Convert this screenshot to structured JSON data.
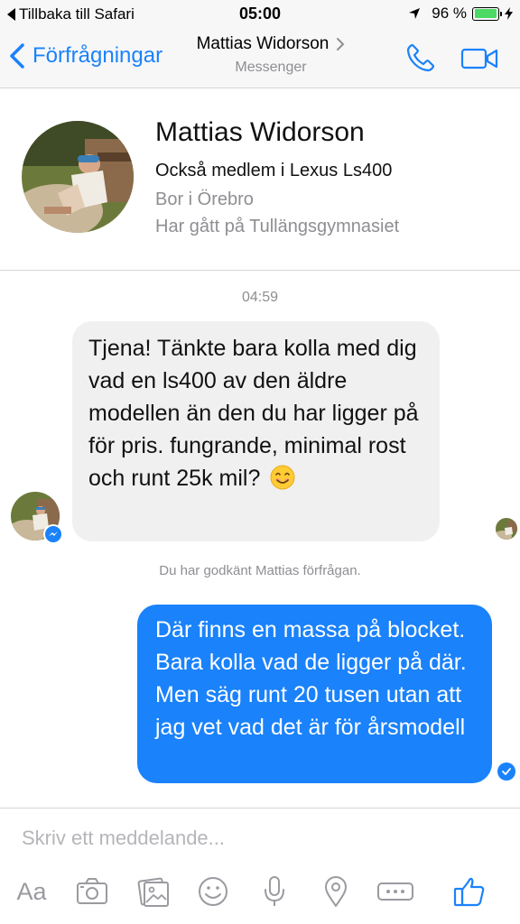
{
  "status_bar": {
    "back_label": "Tillbaka till Safari",
    "time": "05:00",
    "battery_percent": "96 %",
    "battery_level": 0.96,
    "battery_color": "#4cd964"
  },
  "nav": {
    "back_label": "Förfrågningar",
    "title": "Mattias Widorson",
    "subtitle": "Messenger",
    "accent": "#1a82fb",
    "icons": [
      "chevron-left-icon",
      "chevron-right-icon",
      "phone-icon",
      "video-icon"
    ]
  },
  "profile": {
    "name": "Mattias Widorson",
    "member_of": "Också medlem i  Lexus Ls400",
    "city": "Bor i Örebro",
    "school": "Har gått på Tullängsgymnasiet"
  },
  "conversation": {
    "timestamp": "04:59",
    "incoming": {
      "text": "Tjena! Tänkte bara kolla med dig vad en ls400 av den äldre modellen än den du har ligger på för pris. fungrande, minimal rost och runt 25k mil?",
      "emoji": "smiling-face-icon"
    },
    "system_message": "Du har godkänt Mattias förfrågan.",
    "outgoing": {
      "text": "Där finns en massa på blocket. Bara kolla vad de ligger på där. Men säg runt 20 tusen utan att jag vet vad det är för årsmodell"
    }
  },
  "composer": {
    "placeholder": "Skriv ett meddelande...",
    "toolbar": {
      "text_label": "Aa",
      "icons": [
        "camera-icon",
        "gallery-icon",
        "emoji-icon",
        "microphone-icon",
        "location-icon",
        "more-icon",
        "like-icon"
      ]
    }
  }
}
